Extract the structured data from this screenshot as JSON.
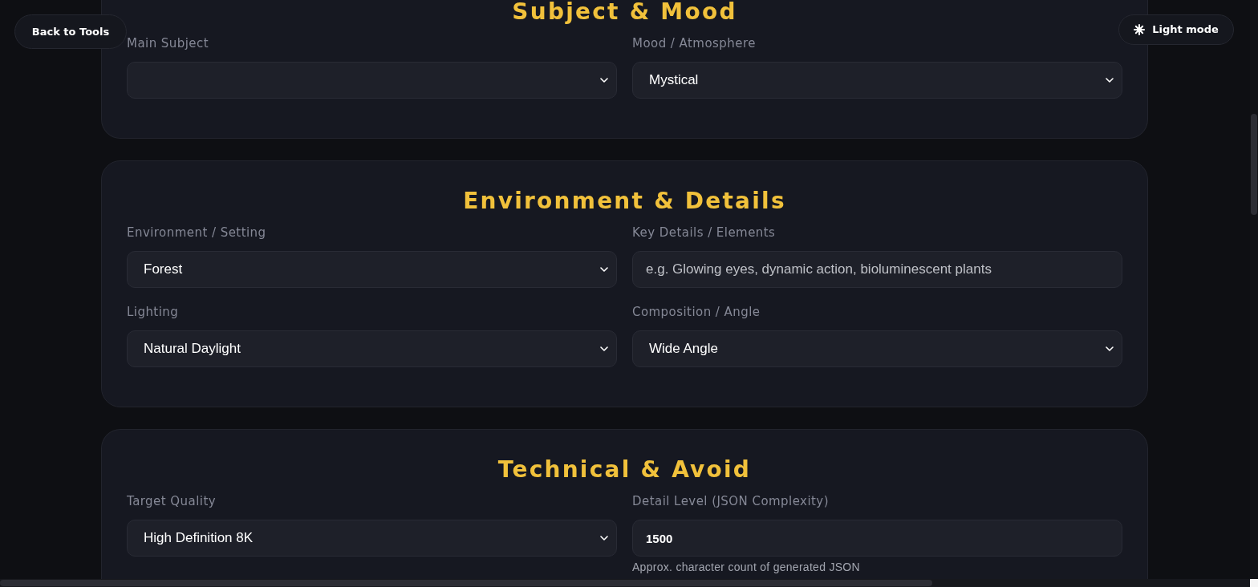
{
  "top_bar": {
    "back_button": "Back to Tools",
    "theme_button": "Light mode"
  },
  "sections": [
    {
      "title": "Subject & Mood",
      "fields": [
        {
          "kind": "select",
          "label": "Main Subject"
        },
        {
          "kind": "select",
          "label": "Mood / Atmosphere",
          "value": "Mystical"
        }
      ]
    },
    {
      "title": "Environment & Details",
      "fields": [
        {
          "kind": "select",
          "label": "Environment / Setting",
          "value": "Forest"
        },
        {
          "kind": "text",
          "label": "Key Details / Elements",
          "placeholder": "e.g. Glowing eyes, dynamic action, bioluminescent plants"
        },
        {
          "kind": "select",
          "label": "Lighting",
          "value": "Natural Daylight"
        },
        {
          "kind": "select",
          "label": "Composition / Angle",
          "value": "Wide Angle"
        }
      ]
    },
    {
      "title": "Technical & Avoid",
      "fields": [
        {
          "kind": "select",
          "label": "Target Quality",
          "value": "High Definition 8K"
        },
        {
          "kind": "number",
          "label": "Detail Level (JSON Complexity)",
          "value": "1500",
          "hint": "Approx. character count of generated JSON"
        }
      ]
    }
  ]
}
